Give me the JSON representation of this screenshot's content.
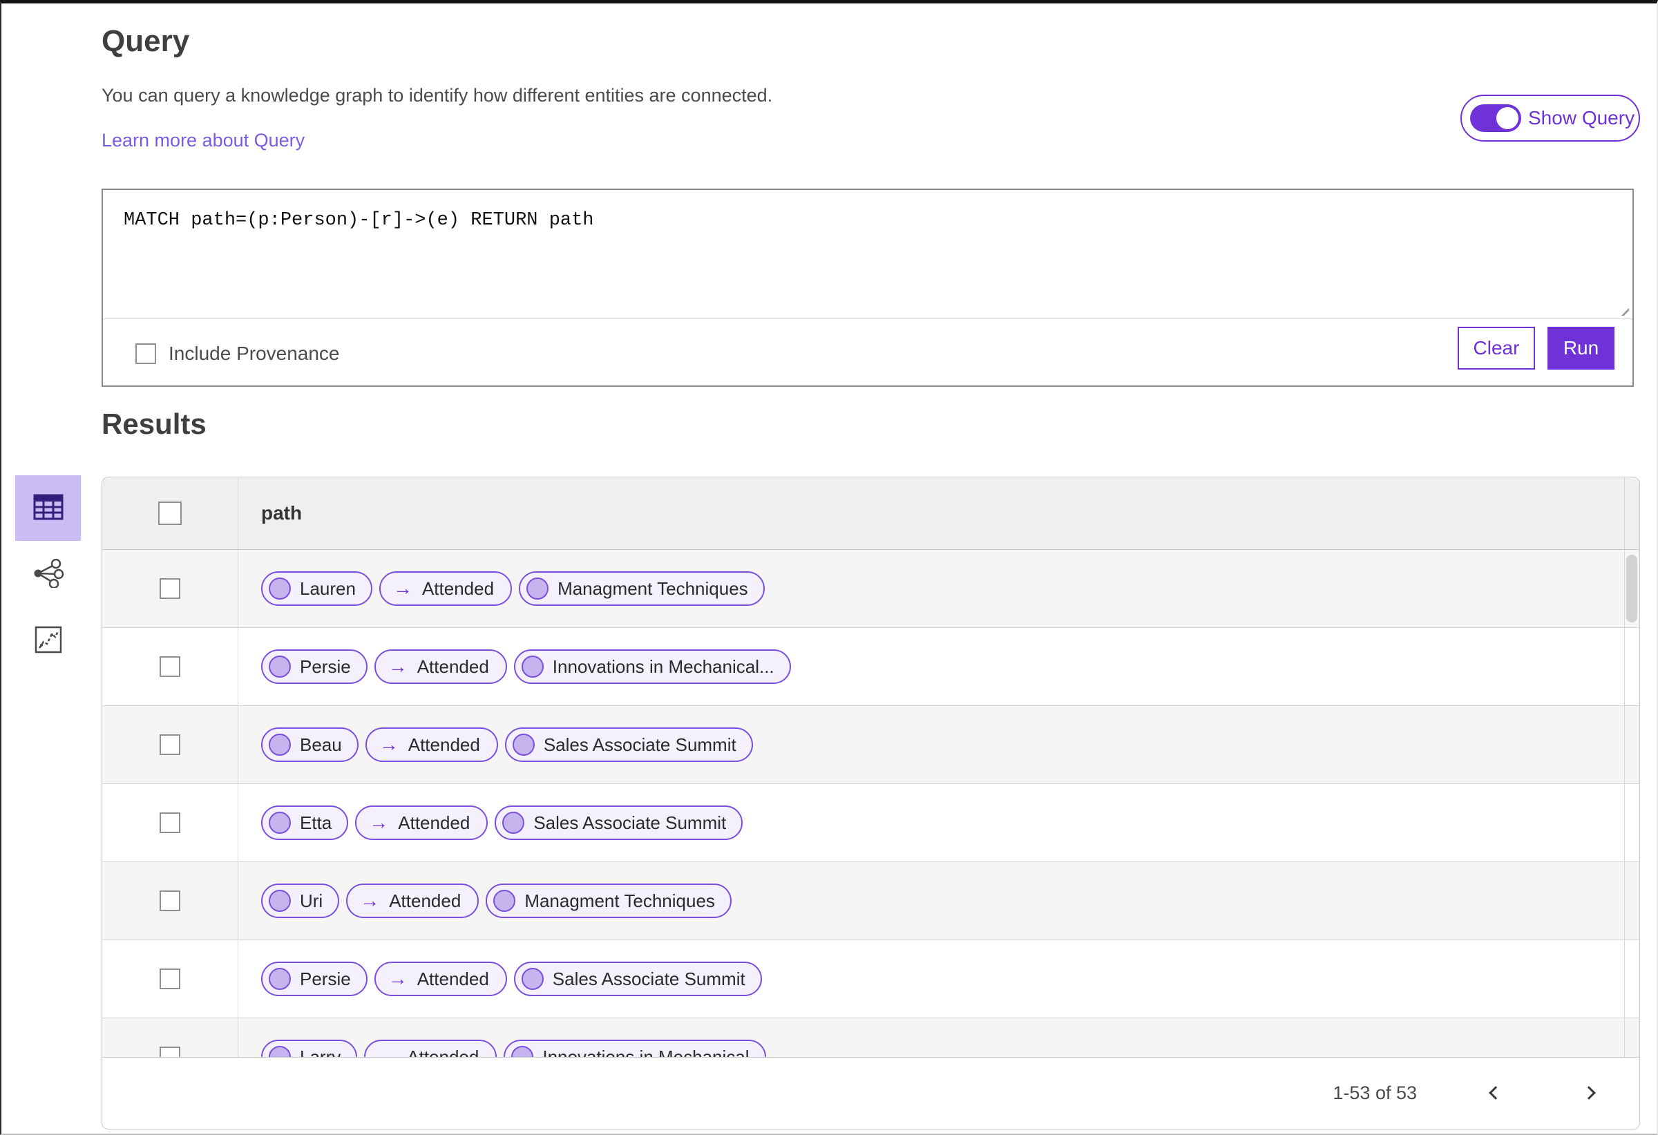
{
  "header": {
    "title": "Query",
    "description": "You can query a knowledge graph to identify how different entities are connected.",
    "learn_more_label": "Learn more about Query",
    "show_query_label": "Show Query",
    "show_query_state": "on"
  },
  "query_panel": {
    "query_text": "MATCH path=(p:Person)-[r]->(e) RETURN path",
    "include_provenance_label": "Include Provenance",
    "include_provenance_checked": false,
    "clear_label": "Clear",
    "run_label": "Run"
  },
  "results": {
    "title": "Results",
    "views": [
      {
        "name": "table-view",
        "selected": true
      },
      {
        "name": "network-view",
        "selected": false
      },
      {
        "name": "chart-view",
        "selected": false
      }
    ],
    "column_header": "path",
    "rows": [
      {
        "node": "Lauren",
        "edge": "Attended",
        "target": "Managment Techniques"
      },
      {
        "node": "Persie",
        "edge": "Attended",
        "target": "Innovations in Mechanical..."
      },
      {
        "node": "Beau",
        "edge": "Attended",
        "target": "Sales Associate Summit"
      },
      {
        "node": "Etta",
        "edge": "Attended",
        "target": "Sales Associate Summit"
      },
      {
        "node": "Uri",
        "edge": "Attended",
        "target": "Managment Techniques"
      },
      {
        "node": "Persie",
        "edge": "Attended",
        "target": "Sales Associate Summit"
      },
      {
        "node": "Larry",
        "edge": "Attended",
        "target": "Innovations in Mechanical"
      }
    ],
    "pagination": {
      "range_label": "1-53 of 53"
    }
  },
  "icons": {
    "arrow_right": "→"
  },
  "colors": {
    "accent": "#6e32d8",
    "link": "#7a5be4",
    "pill_border": "#7b4fdd",
    "pill_bg": "#f4f1fc",
    "node_fill": "#c6b4ef",
    "selected_tile_bg": "#cbbcf4",
    "row_alt_bg": "#f5f5f5",
    "header_bg": "#efefef"
  }
}
